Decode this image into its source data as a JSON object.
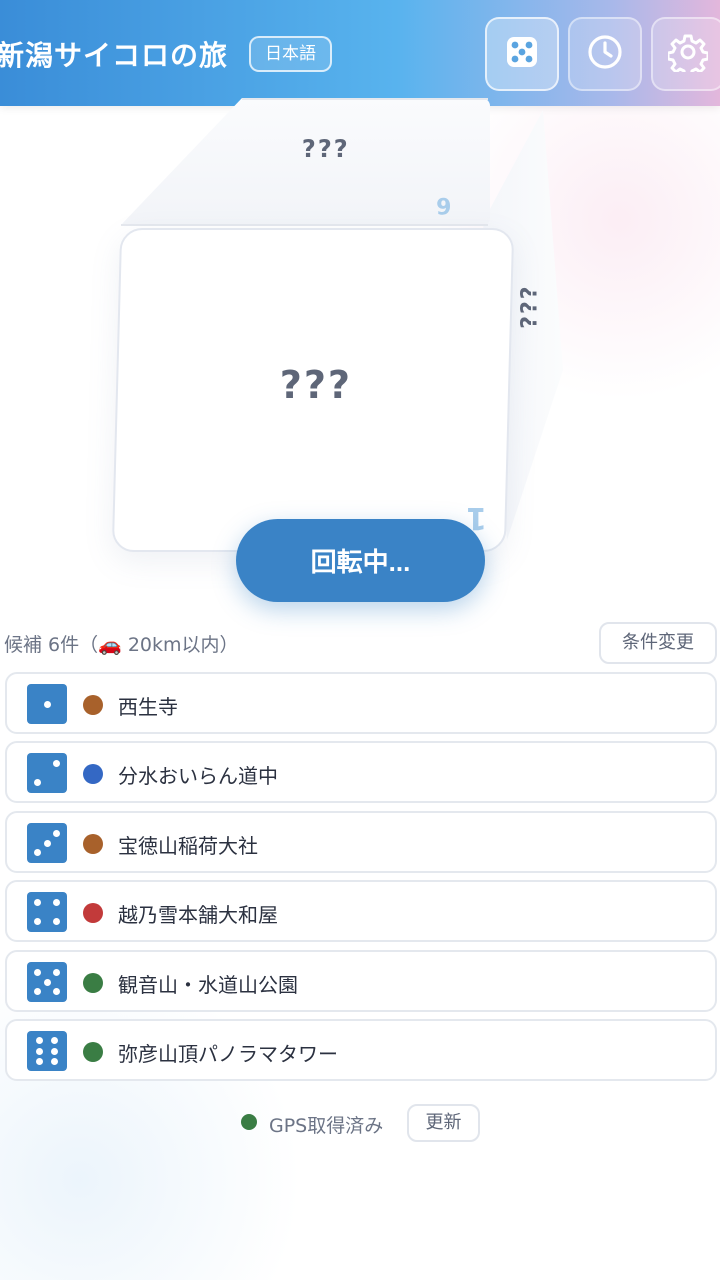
{
  "header": {
    "title": "新潟サイコロの旅",
    "language_badge": "日本語",
    "buttons": [
      {
        "icon": "dice-icon",
        "active": true
      },
      {
        "icon": "history-clock-icon",
        "active": false
      },
      {
        "icon": "gear-icon",
        "active": false
      }
    ]
  },
  "dice": {
    "front_face": "¿¿¿",
    "top_face": "¿¿¿",
    "right_face": "¿¿¿",
    "front_number": "1",
    "top_number": "6"
  },
  "roll_button": {
    "label": "回転中..."
  },
  "candidates": {
    "summary": "候補 6件（🚗 20km以内）",
    "change_conditions_label": "条件変更",
    "items": [
      {
        "face": 1,
        "label": "西生寺",
        "category_color": "#a8612b"
      },
      {
        "face": 2,
        "label": "分水おいらん道中",
        "category_color": "#3468c4"
      },
      {
        "face": 3,
        "label": "宝徳山稲荷大社",
        "category_color": "#a8612b"
      },
      {
        "face": 4,
        "label": "越乃雪本舗大和屋",
        "category_color": "#c23a3a"
      },
      {
        "face": 5,
        "label": "観音山・水道山公園",
        "category_color": "#3a7d44"
      },
      {
        "face": 6,
        "label": "弥彦山頂パノラマタワー",
        "category_color": "#3a7d44"
      }
    ]
  },
  "gps": {
    "status": "GPS取得済み",
    "status_color": "#3a7d44",
    "refresh_label": "更新"
  },
  "colors": {
    "accent": "#3a83c6"
  }
}
